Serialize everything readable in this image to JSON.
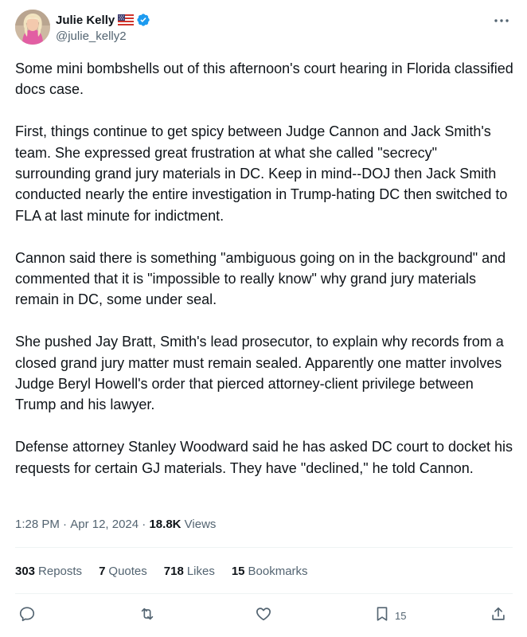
{
  "author": {
    "display_name": "Julie Kelly",
    "handle": "@julie_kelly2",
    "flag_icon": "us-flag-icon",
    "verified_icon": "verified-badge-icon",
    "verified_color": "#1d9bf0"
  },
  "tweet": {
    "paragraphs": [
      "Some mini bombshells out of this afternoon's court hearing in Florida classified docs case.",
      "First, things continue to get spicy between Judge Cannon and Jack Smith's team. She expressed great frustration at what she called \"secrecy\" surrounding grand jury materials in DC. Keep in mind--DOJ then Jack Smith conducted nearly the entire investigation in Trump-hating DC then switched to FLA at last minute for indictment.",
      "Cannon said there is something \"ambiguous going on in the background\" and commented that it is \"impossible to really know\" why grand jury materials remain in DC, some under seal.",
      "She pushed Jay Bratt, Smith's lead prosecutor, to explain why records from a closed grand jury matter must remain sealed. Apparently one matter involves Judge Beryl Howell's order that pierced attorney-client privilege between Trump and his lawyer.",
      "Defense attorney Stanley Woodward said he has asked DC court to docket his requests for certain GJ materials. They have \"declined,\" he told Cannon."
    ],
    "time": "1:28 PM",
    "date": "Apr 12, 2024",
    "views_count": "18.8K",
    "views_label": "Views"
  },
  "stats": {
    "reposts_count": "303",
    "reposts_label": "Reposts",
    "quotes_count": "7",
    "quotes_label": "Quotes",
    "likes_count": "718",
    "likes_label": "Likes",
    "bookmarks_count": "15",
    "bookmarks_label": "Bookmarks"
  },
  "actions": {
    "reply_icon": "reply-icon",
    "repost_icon": "repost-icon",
    "like_icon": "heart-icon",
    "bookmark_icon": "bookmark-icon",
    "bookmark_count": "15",
    "share_icon": "share-icon"
  },
  "colors": {
    "text_primary": "#0f1419",
    "text_secondary": "#536471",
    "divider": "#eff3f4",
    "icon": "#536471"
  }
}
